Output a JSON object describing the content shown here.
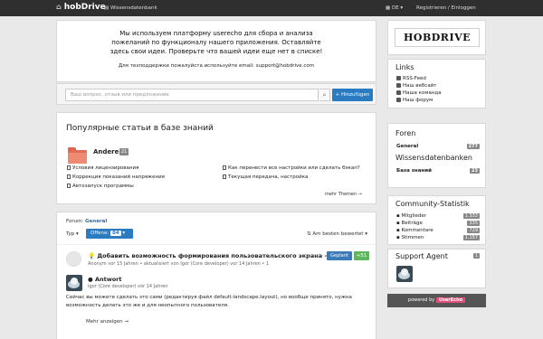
{
  "topbar": {
    "brand": "hobDrive",
    "kb": "Wissensdatenbank",
    "lang": "DE",
    "login": "Registrieren / Einloggen"
  },
  "intro": {
    "message": "Мы используем платформу userecho для сбора и анализа пожеланий по функционалу нашего приложения. Оставляйте здесь свои идеи. Проверьте что вашей идеи еще нет в списке!",
    "support": "Для техподдержки пожалуйста используйте email: support@hobdrive.com"
  },
  "search": {
    "placeholder": "Ваш вопрос, отзыв или предложение",
    "add_label": "+ Hinzufügen"
  },
  "popular": {
    "title": "Популярные статьи в базе знаний",
    "category": "Andere",
    "category_count": "21",
    "articles_left": [
      "Условия лицензирования",
      "Коррекция показаний напряжения",
      "Автозапуск программы"
    ],
    "articles_right": [
      "Как перенести все настройки или сделать бэкап?",
      "Текущая передача, настройка"
    ],
    "more": "mehr Themen →"
  },
  "forum": {
    "label": "Forum:",
    "name": "General",
    "type": "Typ",
    "status": "Offene:",
    "status_count": "84",
    "sort": "Am besten bewertet",
    "idea": {
      "title": "Добавить возможность формирования пользовательского экрана - ...",
      "meta": "Anonym vor 15 Jahren • aktualisiert von Igor (Core developer) vor 14 Jahren • 1",
      "status": "Geplant",
      "votes": "+51"
    },
    "answer": {
      "title": "Antwort",
      "meta": "Igor (Core developer) vor 14 Jahren",
      "text": "Сейчас вы можете сделать это сами (редактируя файл default-landscape.layout), но вообще принято, нужна возможность делать это же и для неопытного пользователя.",
      "more": "Mehr anzeigen →"
    }
  },
  "sidebar": {
    "logo": "HOBDRIVE",
    "links_title": "Links",
    "links": [
      "RSS-Feed",
      "Наш вебсайт",
      "Наша команда",
      "Наш форум"
    ],
    "foren_title": "Foren",
    "foren": [
      {
        "name": "General",
        "count": "277"
      }
    ],
    "kb_title": "Wissensdatenbanken",
    "kb": [
      {
        "name": "База знаний",
        "count": "23"
      }
    ],
    "stats_title": "Community-Statistik",
    "stats": [
      {
        "name": "Mitglieder",
        "count": "1.333"
      },
      {
        "name": "Beiträge",
        "count": "335"
      },
      {
        "name": "Kommentare",
        "count": "729"
      },
      {
        "name": "Stimmen",
        "count": "1.157"
      }
    ],
    "agent_title": "Support Agent",
    "agent_count": "1",
    "powered_prefix": "powered by",
    "powered_brand": "UserEcho"
  }
}
